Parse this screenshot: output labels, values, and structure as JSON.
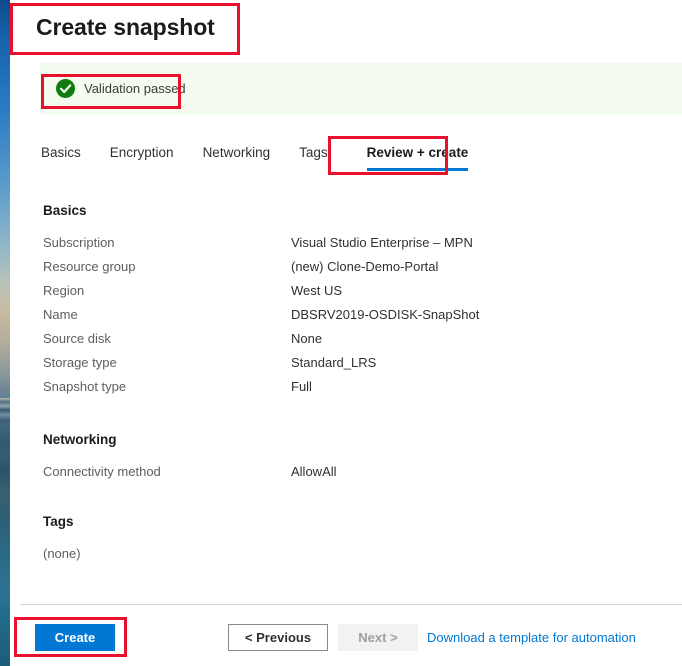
{
  "page": {
    "title": "Create snapshot"
  },
  "validation": {
    "icon": "check-circle-icon",
    "text": "Validation passed",
    "accent_color": "#107c10",
    "background_color": "#f4fbef"
  },
  "tabs": [
    {
      "label": "Basics",
      "active": false
    },
    {
      "label": "Encryption",
      "active": false
    },
    {
      "label": "Networking",
      "active": false
    },
    {
      "label": "Tags",
      "active": false
    },
    {
      "label": "Review + create",
      "active": true
    }
  ],
  "sections": {
    "basics": {
      "heading": "Basics",
      "rows": [
        {
          "key": "Subscription",
          "value": "Visual Studio Enterprise – MPN"
        },
        {
          "key": "Resource group",
          "value": "(new) Clone-Demo-Portal"
        },
        {
          "key": "Region",
          "value": "West US"
        },
        {
          "key": "Name",
          "value": "DBSRV2019-OSDISK-SnapShot"
        },
        {
          "key": "Source disk",
          "value": "None"
        },
        {
          "key": "Storage type",
          "value": "Standard_LRS"
        },
        {
          "key": "Snapshot type",
          "value": "Full"
        }
      ]
    },
    "networking": {
      "heading": "Networking",
      "rows": [
        {
          "key": "Connectivity method",
          "value": "AllowAll"
        }
      ]
    },
    "tags": {
      "heading": "Tags",
      "empty_text": "(none)"
    }
  },
  "footer": {
    "create_label": "Create",
    "previous_label": "< Previous",
    "next_label": "Next >",
    "next_disabled": true,
    "download_link_label": "Download a template for automation",
    "link_color": "#0078d4",
    "primary_color": "#0078d4"
  },
  "annotations": {
    "color": "#e8102d",
    "boxes": [
      {
        "target": "page-title"
      },
      {
        "target": "validation-message"
      },
      {
        "target": "tab-review-create"
      },
      {
        "target": "create-button"
      }
    ]
  }
}
